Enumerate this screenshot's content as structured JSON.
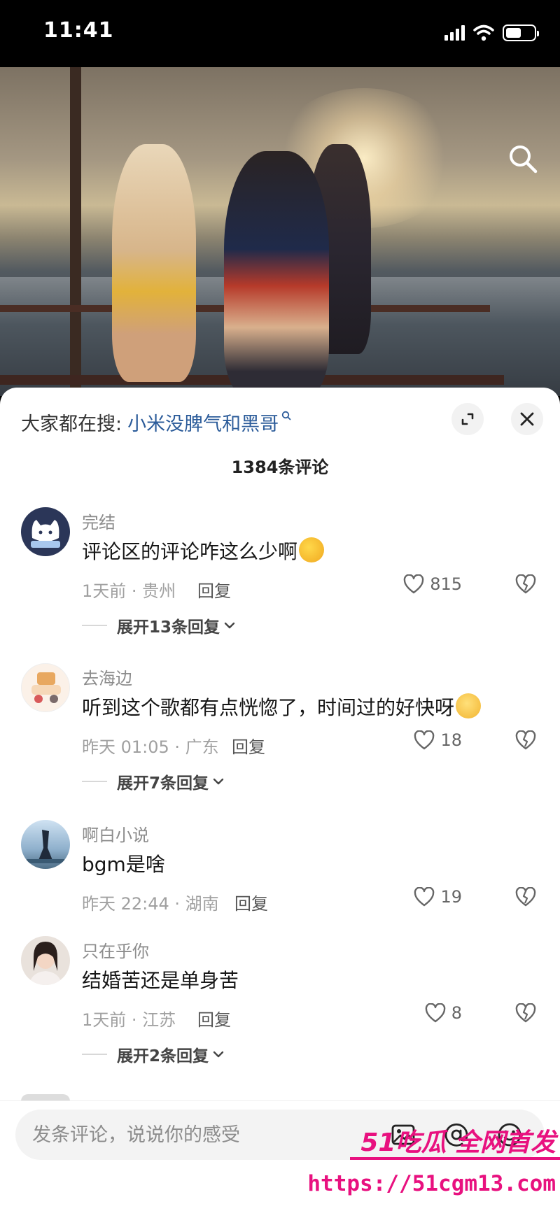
{
  "status_bar": {
    "time": "11:41"
  },
  "sheet": {
    "trending_prefix": "大家都在搜:",
    "trending_term": "小米没脾气和黑哥",
    "comment_count_title": "1384条评论"
  },
  "comments": [
    {
      "user": "完结",
      "text": "评论区的评论咋这么少啊",
      "time_loc": "1天前 · 贵州",
      "reply": "回复",
      "likes": "815",
      "expand": "展开13条回复",
      "emoji": "zany-face"
    },
    {
      "user": "去海边",
      "text": "听到这个歌都有点恍惚了，时间过的好快呀",
      "time_loc": "昨天 01:05 · 广东",
      "reply": "回复",
      "likes": "18",
      "expand": "展开7条回复",
      "emoji": "teary-face"
    },
    {
      "user": "啊白小说",
      "text": "bgm是啥",
      "time_loc": "昨天 22:44 · 湖南",
      "reply": "回复",
      "likes": "19"
    },
    {
      "user": "只在乎你",
      "text": "结婚苦还是单身苦",
      "time_loc": "1天前 · 江苏",
      "reply": "回复",
      "likes": "8",
      "expand": "展开2条回复"
    }
  ],
  "input": {
    "placeholder": "发条评论，说说你的感受"
  },
  "watermark": {
    "line1": "51吃瓜 全网首发",
    "url": "https://51cgm13.com"
  },
  "colors": {
    "link": "#2c5c9a",
    "watermark": "#e8117f"
  }
}
